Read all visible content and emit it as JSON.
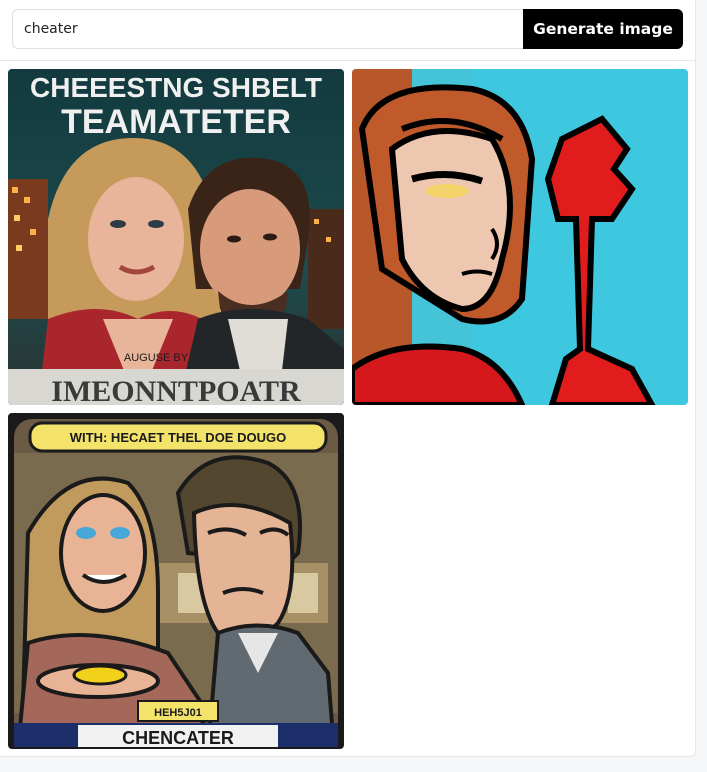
{
  "search": {
    "value": "cheater",
    "placeholder": ""
  },
  "generate_button": {
    "label": "Generate image"
  },
  "results": [
    {
      "id": "image-1",
      "caption_top_line1": "CHEEESTNG SHBELT",
      "caption_top_line2": "TEAMATETER",
      "caption_mid": "AUGUSE BY",
      "caption_bottom": "IMEONNTPOATR"
    },
    {
      "id": "image-2"
    },
    {
      "id": "image-3",
      "caption_top": "WITH: HECAET THEL DOE DOUGO",
      "caption_badge": "HEH5J01",
      "caption_bottom": "CHENCATER"
    }
  ],
  "colors": {
    "button_bg": "#000000",
    "button_text": "#ffffff",
    "border": "#dcdfe4",
    "page_bg": "#f6f7f9"
  }
}
